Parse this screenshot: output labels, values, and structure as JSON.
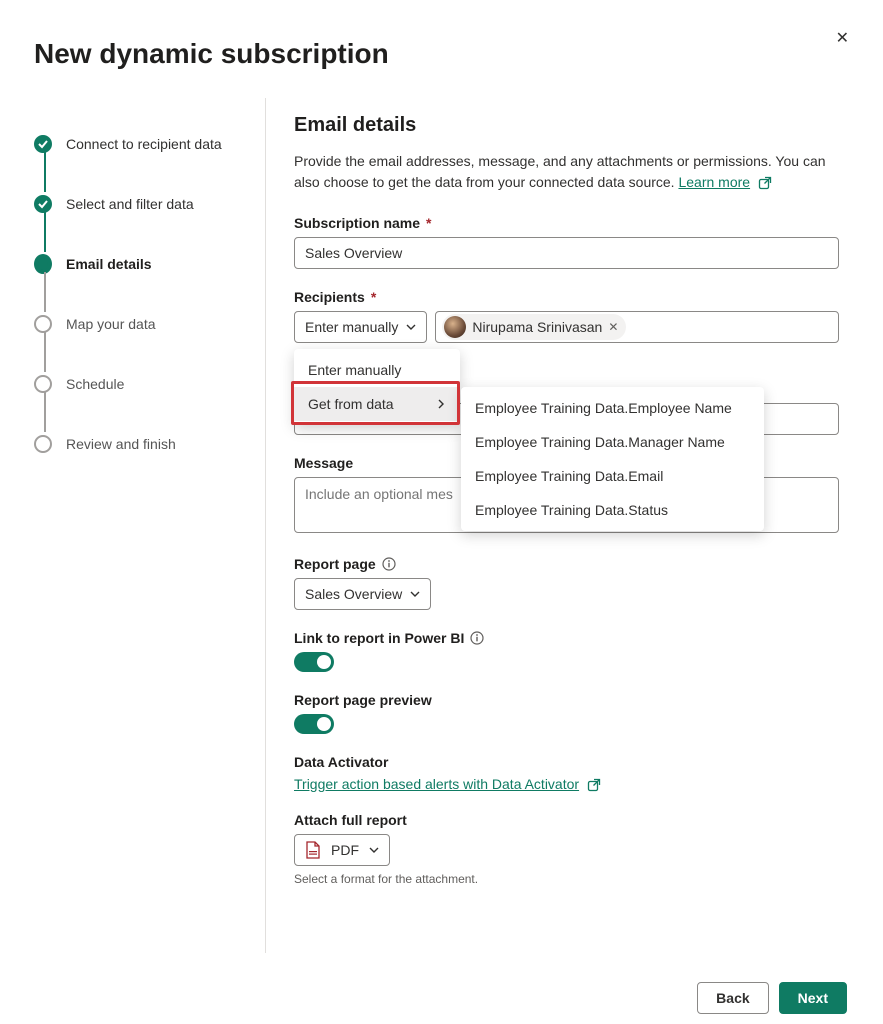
{
  "dialog": {
    "title": "New dynamic subscription",
    "close_label": "✕"
  },
  "steps": [
    {
      "label": "Connect to recipient data",
      "state": "done"
    },
    {
      "label": "Select and filter data",
      "state": "done"
    },
    {
      "label": "Email details",
      "state": "current"
    },
    {
      "label": "Map your data",
      "state": "pending"
    },
    {
      "label": "Schedule",
      "state": "pending"
    },
    {
      "label": "Review and finish",
      "state": "pending"
    }
  ],
  "section": {
    "title": "Email details",
    "description": "Provide the email addresses, message, and any attachments or permissions. You can also choose to get the data from your connected data source.",
    "learn_more": "Learn more"
  },
  "fields": {
    "subscription_name": {
      "label": "Subscription name",
      "value": "Sales Overview"
    },
    "recipients": {
      "label": "Recipients",
      "mode_selected": "Enter manually",
      "chip_name": "Nirupama Srinivasan",
      "menu": {
        "item_manual": "Enter manually",
        "item_from_data": "Get from data"
      },
      "submenu_items": [
        "Employee Training Data.Employee Name",
        "Employee Training Data.Manager Name",
        "Employee Training Data.Email",
        "Employee Training Data.Status"
      ]
    },
    "subject": {},
    "message": {
      "label": "Message",
      "placeholder": "Include an optional mes"
    },
    "report_page": {
      "label": "Report page",
      "value": "Sales Overview"
    },
    "link_to_report": {
      "label": "Link to report in Power BI"
    },
    "page_preview": {
      "label": "Report page preview"
    },
    "data_activator": {
      "label": "Data Activator",
      "link": "Trigger action based alerts with Data Activator"
    },
    "attach": {
      "label": "Attach full report",
      "format": "PDF",
      "hint": "Select a format for the attachment."
    }
  },
  "buttons": {
    "back": "Back",
    "next": "Next"
  }
}
